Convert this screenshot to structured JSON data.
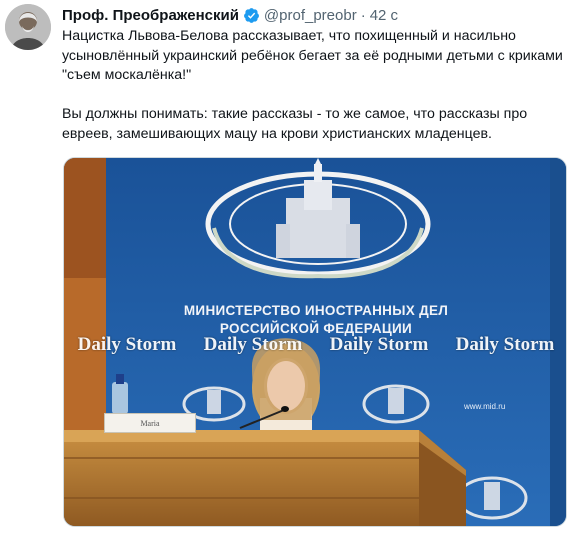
{
  "tweet": {
    "display_name": "Проф. Преображенский",
    "handle": "@prof_preobr",
    "separator": "·",
    "time": "42 с",
    "text": "Нацистка Львова-Белова рассказывает, что похищенный и насильно усыновлённый украинский ребёнок бегает за её родными детьми с криками \"съем москалёнка!\"\n\nВы должны понимать: такие рассказы - то же самое, что рассказы про евреев, замешивающих мацу на крови христианских младенцев."
  },
  "media": {
    "ministry_line1": "МИНИСТЕРСТВО ИНОСТРАННЫХ ДЕЛ",
    "ministry_line2": "РОССИЙСКОЙ ФЕДЕРАЦИИ",
    "watermark": [
      "Daily Storm",
      "Daily Storm",
      "Daily Storm",
      "Daily Storm"
    ],
    "site": "www.mid.ru",
    "nameplate": "Maria"
  },
  "colors": {
    "verified": "#1d9bf0",
    "backdrop_blue": "#1f5fa6",
    "podium": "#b07a34"
  },
  "icons": [
    "verified-badge-icon",
    "mfa-emblem-icon"
  ]
}
